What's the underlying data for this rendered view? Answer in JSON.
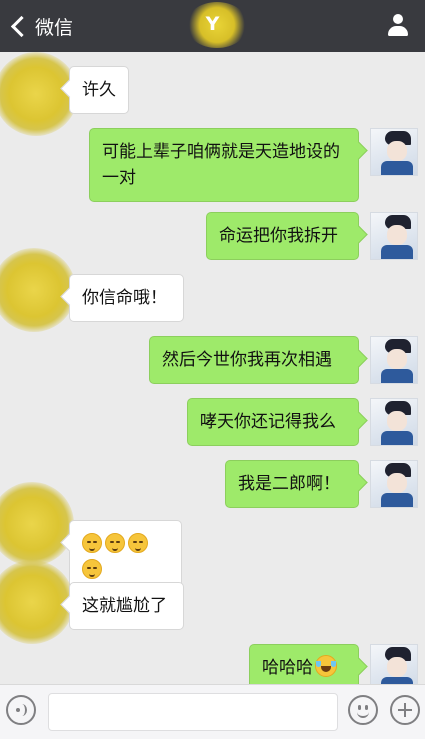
{
  "header": {
    "back_label": "微信",
    "title": "Y",
    "profile_icon": "person-icon"
  },
  "messages": [
    {
      "side": "left",
      "text": "许久"
    },
    {
      "side": "right",
      "text": "可能上辈子咱俩就是天造地设的一对"
    },
    {
      "side": "right",
      "text": "命运把你我拆开"
    },
    {
      "side": "left",
      "text": "你信命哦！"
    },
    {
      "side": "right",
      "text": "然后今世你我再次相遇"
    },
    {
      "side": "right",
      "text": "哮天你还记得我么"
    },
    {
      "side": "right",
      "text": "我是二郎啊！"
    },
    {
      "side": "left",
      "text": "",
      "emoji": [
        "smiling-face-emoji",
        "smiling-face-emoji",
        "smiling-face-emoji",
        "smiling-face-emoji"
      ]
    },
    {
      "side": "left",
      "text": "这就尴尬了"
    },
    {
      "side": "right",
      "text": "哈哈哈",
      "emoji": [
        "tears-of-joy-emoji"
      ]
    }
  ],
  "input_bar": {
    "voice_icon": "voice-icon",
    "emoji_icon": "emoji-icon",
    "plus_icon": "plus-icon",
    "input_value": ""
  },
  "colors": {
    "topbar": "#393a3f",
    "background": "#ebebeb",
    "my_bubble": "#9eea6a",
    "their_bubble": "#ffffff"
  }
}
